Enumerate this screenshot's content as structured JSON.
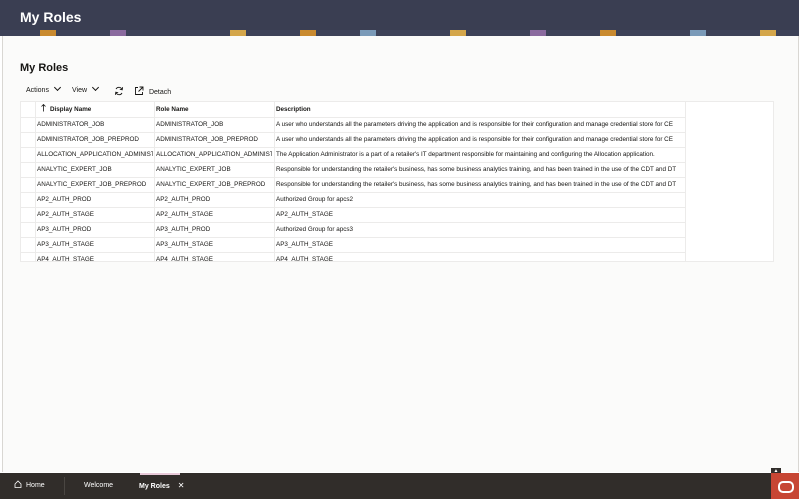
{
  "header": {
    "title": "My Roles"
  },
  "page": {
    "title": "My Roles"
  },
  "toolbar": {
    "actions_label": "Actions",
    "view_label": "View",
    "detach_label": "Detach"
  },
  "table": {
    "columns": [
      "Display Name",
      "Role Name",
      "Description"
    ],
    "rows": [
      [
        "ADMINISTRATOR_JOB",
        "ADMINISTRATOR_JOB",
        "A user who understands all the parameters driving the application and is responsible for their configuration and manage credential store for CE"
      ],
      [
        "ADMINISTRATOR_JOB_PREPROD",
        "ADMINISTRATOR_JOB_PREPROD",
        "A user who understands all the parameters driving the application and is responsible for their configuration and manage credential store for CE"
      ],
      [
        "ALLOCATION_APPLICATION_ADMINISTI",
        "ALLOCATION_APPLICATION_ADMINISTI",
        "The Application Administrator is a part of a retailer's IT department responsible for maintaining and configuring the Allocation application."
      ],
      [
        "ANALYTIC_EXPERT_JOB",
        "ANALYTIC_EXPERT_JOB",
        "Responsible for understanding the retailer's business, has some business analytics training, and has been trained in the use of the CDT and DT"
      ],
      [
        "ANALYTIC_EXPERT_JOB_PREPROD",
        "ANALYTIC_EXPERT_JOB_PREPROD",
        "Responsible for understanding the retailer's business, has some business analytics training, and has been trained in the use of the CDT and DT"
      ],
      [
        "AP2_AUTH_PROD",
        "AP2_AUTH_PROD",
        "Authorized Group for apcs2"
      ],
      [
        "AP2_AUTH_STAGE",
        "AP2_AUTH_STAGE",
        "AP2_AUTH_STAGE"
      ],
      [
        "AP3_AUTH_PROD",
        "AP3_AUTH_PROD",
        "Authorized Group for apcs3"
      ],
      [
        "AP3_AUTH_STAGE",
        "AP3_AUTH_STAGE",
        "AP3_AUTH_STAGE"
      ],
      [
        "AP4_AUTH_STAGE",
        "AP4_AUTH_STAGE",
        "AP4_AUTH_STAGE"
      ]
    ]
  },
  "footer": {
    "tabs": [
      "Home",
      "Welcome",
      "My Roles"
    ]
  },
  "icons": {
    "sort": "sort-ascending-icon",
    "refresh": "refresh-icon",
    "detach": "detach-icon",
    "home": "home-icon",
    "close": "close-icon"
  },
  "colors": {
    "header_bg": "#3a3e52",
    "footer_bg": "#312d2a",
    "oracle_red": "#c74634"
  }
}
